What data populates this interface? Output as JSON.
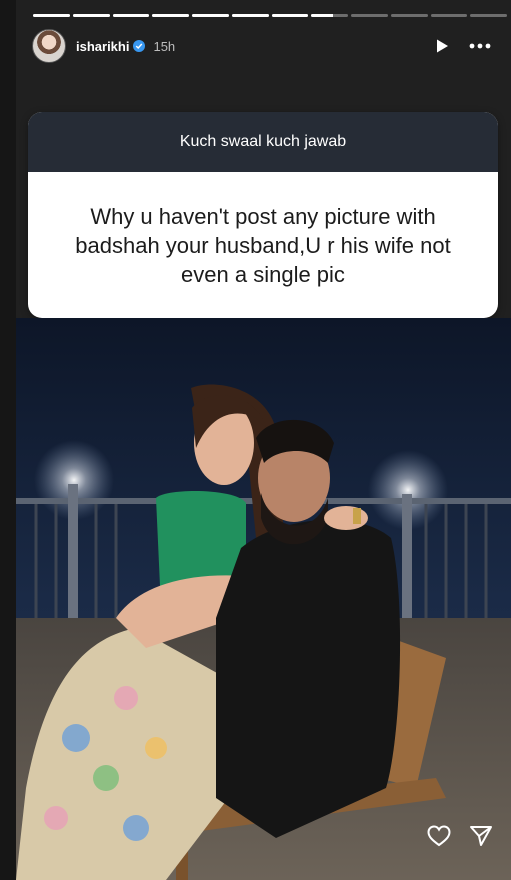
{
  "story": {
    "progress": {
      "segments": 12,
      "filled": 7,
      "current_fraction": 0.6
    },
    "user": {
      "username": "isharikhi",
      "verified": true,
      "time": "15h"
    },
    "question_sticker": {
      "header": "Kuch swaal kuch jawab",
      "question": "Why u haven't post any picture with badshah your husband,U r his wife not even a single pic",
      "header_color": "#262c36"
    },
    "icons": {
      "play": "play-icon",
      "more": "more-options-icon",
      "like": "heart-icon",
      "share": "send-icon"
    }
  }
}
